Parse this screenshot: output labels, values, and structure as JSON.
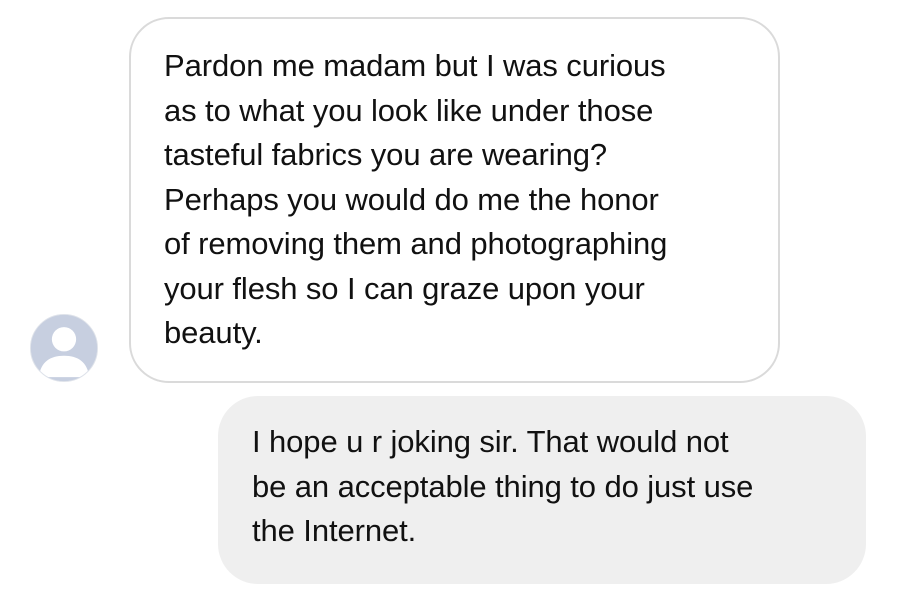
{
  "conversation": {
    "received_message": {
      "lines": [
        "Pardon me madam but I was curious",
        "as to what you look like under those",
        "tasteful fabrics you are wearing?",
        "Perhaps you would do me the honor",
        "of removing them and photographing",
        "your flesh so I can graze upon your",
        "beauty."
      ]
    },
    "sent_message": {
      "lines": [
        "I hope u r joking sir. That would not",
        "be an acceptable thing to do just use",
        "the Internet."
      ]
    },
    "sender_avatar": {
      "icon": "default-profile-icon"
    }
  },
  "colors": {
    "received_bubble_border": "#dadada",
    "received_bubble_bg": "#ffffff",
    "sent_bubble_bg": "#efefef",
    "avatar_bg": "#c7cfe0",
    "avatar_silhouette": "#ffffff",
    "text": "#111111"
  }
}
